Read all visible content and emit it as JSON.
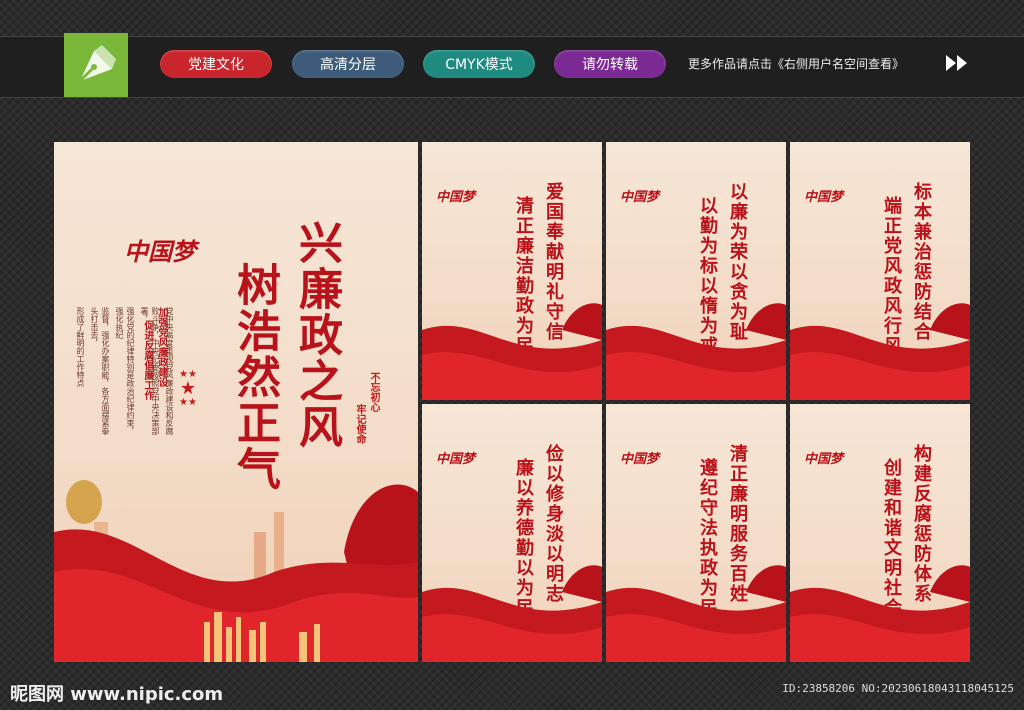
{
  "toolbar": {
    "tag_1": "党建文化",
    "tag_2": "高清分层",
    "tag_3": "CMYK模式",
    "tag_4": "请勿转载",
    "more_text": "更多作品请点击《右侧用户名空间查看》"
  },
  "main_poster": {
    "brand": "中国梦",
    "title_line1": "兴廉政之风",
    "title_line2": "树浩然正气",
    "subtitle_line1": "加强党风廉政建设",
    "subtitle_line2": "促进反腐倡廉工作",
    "body": [
      "党中央高度重视党风廉政建设和反腐",
      "败斗争，中央纪委按照党中央决策部署，",
      "强化党的纪律特别是政治纪律约束，强化执纪",
      "监督，强化办案职能，各方面摆紧拳头打击去，",
      "形成了鲜明的工作特点"
    ],
    "slogan_1": "不忘初心",
    "slogan_2": "牢记使命"
  },
  "small_posters": [
    {
      "line1": "爱国奉献明礼守信",
      "line2": "清正廉洁勤政为民"
    },
    {
      "line1": "以廉为荣以贪为耻",
      "line2": "以勤为标以惰为戒"
    },
    {
      "line1": "标本兼治惩防结合",
      "line2": "端正党风政风行风"
    },
    {
      "line1": "俭以修身淡以明志",
      "line2": "廉以养德勤以为民"
    },
    {
      "line1": "清正廉明服务百姓",
      "line2": "遵纪守法执政为民"
    },
    {
      "line1": "构建反腐惩防体系",
      "line2": "创建和谐文明社会"
    }
  ],
  "footer": {
    "site": "昵图网 www.nipic.com",
    "id_text": "ID:23858206 NO:20230618043118045125"
  }
}
